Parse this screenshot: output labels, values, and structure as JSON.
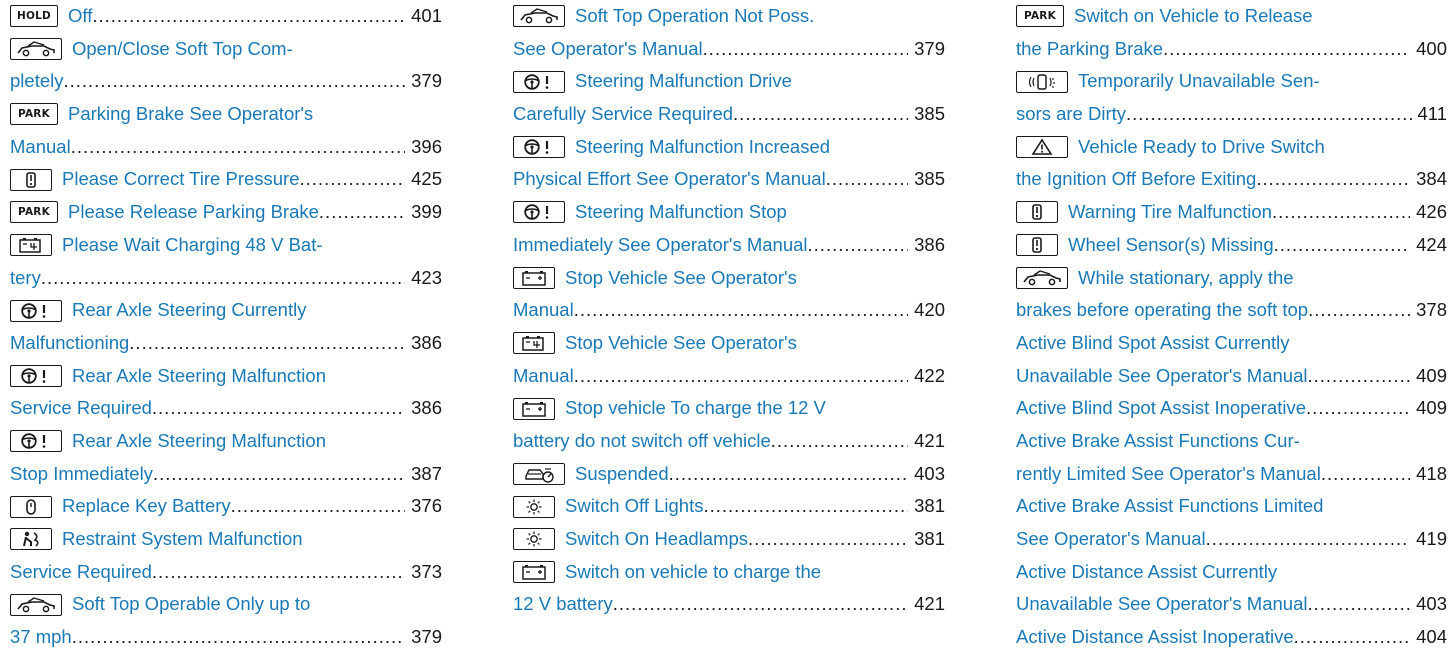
{
  "columns": [
    {
      "entries": [
        {
          "icon": "hold",
          "lines": [
            "Off"
          ],
          "page": "401"
        },
        {
          "icon": "convertible-car",
          "lines": [
            "Open/Close Soft Top Com-",
            "pletely"
          ],
          "page": "379"
        },
        {
          "icon": "park",
          "lines": [
            "Parking Brake See Operator's",
            "Manual"
          ],
          "page": "396"
        },
        {
          "icon": "tire-pressure",
          "lines": [
            "Please Correct Tire Pressure"
          ],
          "page": "425"
        },
        {
          "icon": "park",
          "lines": [
            "Please Release Parking Brake"
          ],
          "page": "399"
        },
        {
          "icon": "battery-48v",
          "lines": [
            "Please Wait Charging 48 V Bat-",
            "tery"
          ],
          "page": "423"
        },
        {
          "icon": "steering-warning",
          "lines": [
            "Rear Axle Steering Currently",
            "Malfunctioning"
          ],
          "page": "386"
        },
        {
          "icon": "steering-warning",
          "lines": [
            "Rear Axle Steering Malfunction",
            "Service Required"
          ],
          "page": "386"
        },
        {
          "icon": "steering-warning",
          "lines": [
            "Rear Axle Steering Malfunction",
            "Stop Immediately"
          ],
          "page": "387"
        },
        {
          "icon": "key-battery",
          "lines": [
            "Replace Key Battery"
          ],
          "page": "376"
        },
        {
          "icon": "airbag",
          "lines": [
            "Restraint System Malfunction",
            "Service Required"
          ],
          "page": "373"
        },
        {
          "icon": "convertible-car",
          "lines": [
            "Soft Top Operable Only up to",
            "37 mph"
          ],
          "page": "379"
        }
      ]
    },
    {
      "entries": [
        {
          "icon": "convertible-car",
          "lines": [
            "Soft Top Operation Not Poss.",
            "See Operator's Manual"
          ],
          "page": "379"
        },
        {
          "icon": "steering-warning",
          "lines": [
            "Steering Malfunction Drive",
            "Carefully Service Required"
          ],
          "page": "385"
        },
        {
          "icon": "steering-warning",
          "lines": [
            "Steering Malfunction Increased",
            "Physical Effort See Operator's Manual"
          ],
          "page": "385"
        },
        {
          "icon": "steering-warning",
          "lines": [
            "Steering Malfunction Stop",
            "Immediately See Operator's Manual"
          ],
          "page": "386"
        },
        {
          "icon": "battery-12v",
          "lines": [
            "Stop Vehicle See Operator's",
            "Manual"
          ],
          "page": "420"
        },
        {
          "icon": "battery-48v",
          "lines": [
            "Stop Vehicle See Operator's",
            "Manual"
          ],
          "page": "422"
        },
        {
          "icon": "battery-12v",
          "lines": [
            "Stop vehicle To charge the 12 V",
            "battery do not switch off vehicle"
          ],
          "page": "421"
        },
        {
          "icon": "suspension",
          "lines": [
            "Suspended"
          ],
          "page": "403"
        },
        {
          "icon": "lights",
          "lines": [
            "Switch Off Lights"
          ],
          "page": "381"
        },
        {
          "icon": "lights",
          "lines": [
            "Switch On Headlamps"
          ],
          "page": "381"
        },
        {
          "icon": "battery-12v",
          "lines": [
            "Switch on vehicle to charge the",
            "12 V battery"
          ],
          "page": "421"
        }
      ]
    },
    {
      "entries": [
        {
          "icon": "park",
          "lines": [
            "Switch on Vehicle to Release",
            "the Parking Brake"
          ],
          "page": "400"
        },
        {
          "icon": "dirty-sensors",
          "lines": [
            "Temporarily Unavailable Sen-",
            "sors are Dirty"
          ],
          "page": "411"
        },
        {
          "icon": "warning-triangle",
          "lines": [
            "Vehicle Ready to Drive Switch",
            "the Ignition Off Before Exiting"
          ],
          "page": "384"
        },
        {
          "icon": "tire-pressure",
          "lines": [
            "Warning Tire Malfunction"
          ],
          "page": "426"
        },
        {
          "icon": "tire-pressure",
          "lines": [
            "Wheel Sensor(s) Missing"
          ],
          "page": "424"
        },
        {
          "icon": "convertible-car",
          "lines": [
            "While stationary, apply the",
            "brakes before operating the soft top"
          ],
          "page": "378"
        },
        {
          "icon": "",
          "lines": [
            "Active Blind Spot Assist Currently",
            "Unavailable See Operator's Manual"
          ],
          "page": "409"
        },
        {
          "icon": "",
          "lines": [
            "Active Blind Spot Assist Inoperative"
          ],
          "page": "409"
        },
        {
          "icon": "",
          "lines": [
            "Active Brake Assist Functions Cur-",
            "rently Limited See Operator's Manual"
          ],
          "page": "418"
        },
        {
          "icon": "",
          "lines": [
            "Active Brake Assist Functions Limited",
            "See Operator's Manual"
          ],
          "page": "419"
        },
        {
          "icon": "",
          "lines": [
            "Active Distance Assist Currently",
            "Unavailable See Operator's Manual"
          ],
          "page": "403"
        },
        {
          "icon": "",
          "lines": [
            "Active Distance Assist Inoperative"
          ],
          "page": "404"
        }
      ]
    }
  ],
  "icon_labels": {
    "hold": "HOLD",
    "park": "PARK"
  },
  "colors": {
    "link": "#1a79b6",
    "text": "#1a1a1a"
  }
}
